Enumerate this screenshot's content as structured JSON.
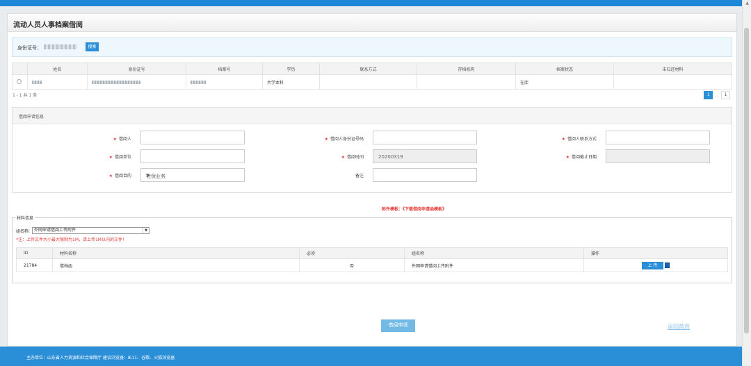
{
  "page": {
    "title": "流动人员人事档案借阅",
    "accent": "#2a8fd6",
    "topbar_color": "#1e88d8"
  },
  "search": {
    "label": "身份证号：",
    "button": "搜索"
  },
  "employee_table": {
    "headers": [
      "姓名",
      "身份证号",
      "档案号",
      "学历",
      "联系方式",
      "存档机构",
      "档案状态",
      "未归还材料"
    ],
    "row": {
      "education": "大学本科",
      "status": "在库"
    },
    "summary": "1 - 1 共 1 条"
  },
  "pagination": {
    "current": "1",
    "dots": "...",
    "last": "1"
  },
  "form": {
    "section_title": "借阅申请信息",
    "borrower_label": "借阅人",
    "borrower_id_label": "借阅人身份证号码",
    "borrower_contact_label": "借阅人联系方式",
    "borrower_unit_label": "借阅单位",
    "borrow_time_label": "借阅时间",
    "borrow_time_value": "20200319",
    "deadline_label": "借阅截止日期",
    "purpose_label": "借阅目的",
    "purpose_value": "社保业务",
    "remarks_label": "备注",
    "required_mark": "★"
  },
  "attachment_note": "附件模板：《下载借阅申请函模板》",
  "materials": {
    "legend": "材料信息",
    "group_label": "组名称:",
    "group_value": "外网申请借阅上传附件",
    "warning": "*注：上传文件大小最大限制为1M，请上传1M以内的文件！",
    "headers": [
      "ID",
      "材料名称",
      "必须",
      "组名称",
      "操作"
    ],
    "rows": [
      {
        "id": "21784",
        "name": "借档函",
        "required": "否",
        "group": "外网申请借阅上传附件",
        "action": "上 传"
      }
    ]
  },
  "actions": {
    "submit": "借阅申请",
    "back": "返回首页"
  },
  "footer": {
    "text": "主办单位：山东省人力资源和社会保障厅   建议浏览器：IE11、谷歌、火狐浏览器"
  }
}
